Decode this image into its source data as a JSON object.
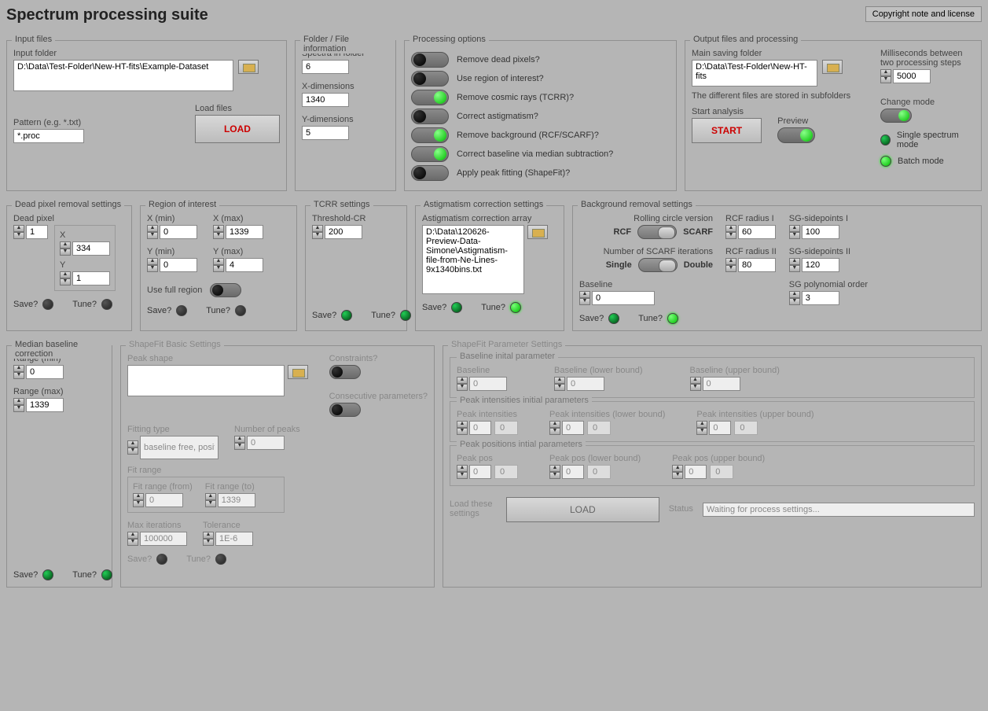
{
  "title": "Spectrum processing suite",
  "license_button": "Copyright note and license",
  "input_files": {
    "legend": "Input files",
    "input_folder_label": "Input folder",
    "input_folder_value": "D:\\Data\\Test-Folder\\New-HT-fits\\Example-Dataset",
    "pattern_label": "Pattern (e.g. *.txt)",
    "pattern_value": "*.proc",
    "load_files_label": "Load files",
    "load_button": "LOAD"
  },
  "folder_info": {
    "legend": "Folder / File information",
    "spectra_label": "Spectra in folder",
    "spectra_value": "6",
    "xdim_label": "X-dimensions",
    "xdim_value": "1340",
    "ydim_label": "Y-dimensions",
    "ydim_value": "5"
  },
  "processing": {
    "legend": "Processing options",
    "opts": [
      "Remove dead pixels?",
      "Use region of interest?",
      "Remove cosmic rays (TCRR)?",
      "Correct astigmatism?",
      "Remove background (RCF/SCARF)?",
      "Correct baseline via median subtraction?",
      "Apply peak fitting (ShapeFit)?"
    ],
    "states": [
      "off",
      "off",
      "on",
      "off",
      "on",
      "on",
      "off"
    ]
  },
  "output": {
    "legend": "Output files and processing",
    "main_saving_label": "Main saving folder",
    "main_saving_value": "D:\\Data\\Test-Folder\\New-HT-fits",
    "subfolders_note": "The different files are stored in subfolders",
    "start_label": "Start analysis",
    "start_button": "START",
    "preview_label": "Preview",
    "ms_label": "Milliseconds between two processing steps",
    "ms_value": "5000",
    "change_mode_label": "Change mode",
    "single_mode": "Single spectrum mode",
    "batch_mode": "Batch mode"
  },
  "dead_pixel": {
    "legend": "Dead pixel removal settings",
    "dead_label": "Dead pixel",
    "dead_value": "1",
    "x_label": "X",
    "x_value": "334",
    "y_label": "Y",
    "y_value": "1"
  },
  "roi": {
    "legend": "Region of interest",
    "xmin_label": "X (min)",
    "xmin_value": "0",
    "xmax_label": "X (max)",
    "xmax_value": "1339",
    "ymin_label": "Y (min)",
    "ymin_value": "0",
    "ymax_label": "Y (max)",
    "ymax_value": "4",
    "full_region_label": "Use full region"
  },
  "tcrr": {
    "legend": "TCRR settings",
    "threshold_label": "Threshold-CR",
    "threshold_value": "200"
  },
  "astig": {
    "legend": "Astigmatism correction settings",
    "array_label": "Astigmatism correction array",
    "array_value": "D:\\Data\\120626-Preview-Data-Simone\\Astigmatism-file-from-Ne-Lines-9x1340bins.txt"
  },
  "bg": {
    "legend": "Background removal settings",
    "rolling_label": "Rolling circle version",
    "rcf": "RCF",
    "scarf": "SCARF",
    "iter_label": "Number of SCARF iterations",
    "single": "Single",
    "double": "Double",
    "baseline_label": "Baseline",
    "baseline_value": "0",
    "rcf_r1_label": "RCF radius I",
    "rcf_r1_value": "60",
    "rcf_r2_label": "RCF radius II",
    "rcf_r2_value": "80",
    "sg1_label": "SG-sidepoints I",
    "sg1_value": "100",
    "sg2_label": "SG-sidepoints II",
    "sg2_value": "120",
    "sgorder_label": "SG polynomial order",
    "sgorder_value": "3"
  },
  "median": {
    "legend": "Median baseline correction",
    "rmin_label": "Range (min)",
    "rmin_value": "0",
    "rmax_label": "Range (max)",
    "rmax_value": "1339"
  },
  "sf_basic": {
    "legend": "ShapeFit Basic Settings",
    "peak_shape_label": "Peak shape",
    "peak_shape_value": "",
    "constraints_label": "Constraints?",
    "consec_label": "Consecutive parameters?",
    "fitting_type_label": "Fitting type",
    "fitting_type_value": "baseline free, positions free",
    "num_peaks_label": "Number of peaks",
    "num_peaks_value": "0",
    "fit_range_label": "Fit range",
    "fit_from_label": "Fit range (from)",
    "fit_from_value": "0",
    "fit_to_label": "Fit range (to)",
    "fit_to_value": "1339",
    "max_iter_label": "Max iterations",
    "max_iter_value": "100000",
    "tol_label": "Tolerance",
    "tol_value": "1E-6"
  },
  "sf_param": {
    "legend": "ShapeFit Parameter Settings",
    "baseline_section": "Baseline inital parameter",
    "baseline_label": "Baseline",
    "baseline_lb": "Baseline (lower bound)",
    "baseline_ub": "Baseline (upper bound)",
    "intens_section": "Peak intensities initial parameters",
    "intens_label": "Peak intensities",
    "intens_lb": "Peak intensities (lower bound)",
    "intens_ub": "Peak intensities (upper bound)",
    "pos_section": "Peak positions intial parameters",
    "pos_label": "Peak pos",
    "pos_lb": "Peak pos (lower bound)",
    "pos_ub": "Peak pos (upper bound)",
    "zero": "0",
    "load_label": "Load these settings",
    "load_button": "LOAD",
    "status_label": "Status",
    "status_value": "Waiting for process settings..."
  },
  "save": "Save?",
  "tune": "Tune?"
}
